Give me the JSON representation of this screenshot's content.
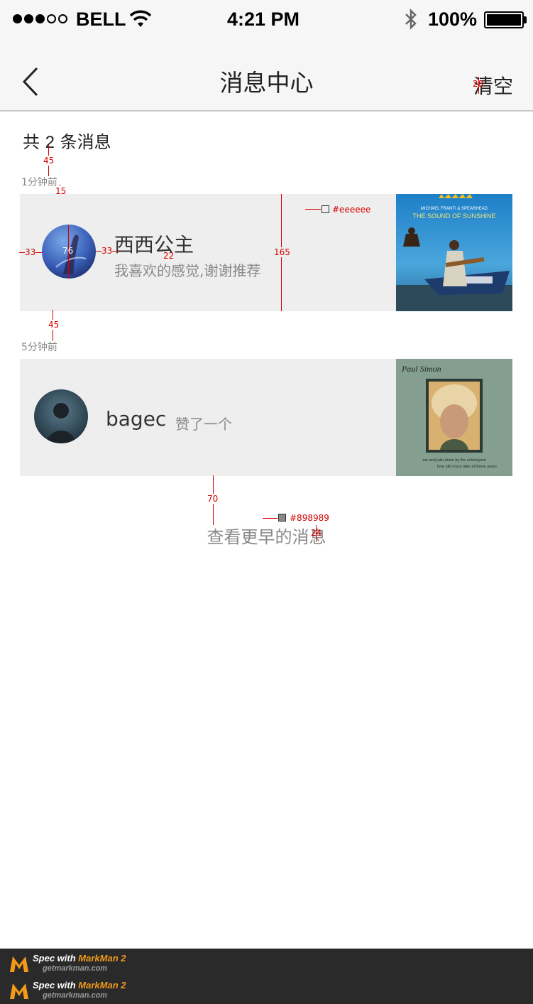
{
  "status_bar": {
    "carrier": "BELL",
    "time": "4:21 PM",
    "battery": "100%",
    "signal_filled": 3,
    "signal_total": 5
  },
  "nav": {
    "title": "消息中心",
    "right_action": "清空",
    "back_icon": "chevron-left-icon"
  },
  "summary": {
    "prefix": "共 ",
    "count": "2",
    "suffix": " 条消息"
  },
  "messages": [
    {
      "time": "1分钟前",
      "name": "西西公主",
      "text": "我喜欢的感觉,谢谢推荐",
      "thumb_title_top": "MICHAEL FRANTI & SPEARHEAD",
      "thumb_title": "THE SOUND OF SUNSHINE"
    },
    {
      "time": "5分钟前",
      "name": "bagec",
      "text": "赞了一个",
      "thumb_title": "Paul Simon",
      "thumb_line1": "me and julio down by the schoolyard",
      "thumb_line2": "love still crazy after all these years"
    }
  ],
  "load_more": "查看更早的消息",
  "annotations": {
    "nav_font": "28",
    "gap_top": "45",
    "gap_label": "15",
    "side_left": "33",
    "avatar": "76",
    "side_right": "33",
    "text_size": "22",
    "card_height": "165",
    "card_color": "#eeeeee",
    "gap_between": "45",
    "gap_more": "70",
    "more_color": "#898989",
    "more_font": "24"
  },
  "colors": {
    "card_bg": "#eeeeee",
    "secondary_text": "#898989",
    "annotation": "#d40000"
  },
  "footer": {
    "line1_prefix": "Spec with ",
    "line1_brand": "MarkMan 2",
    "line2": "getmarkman.com"
  }
}
